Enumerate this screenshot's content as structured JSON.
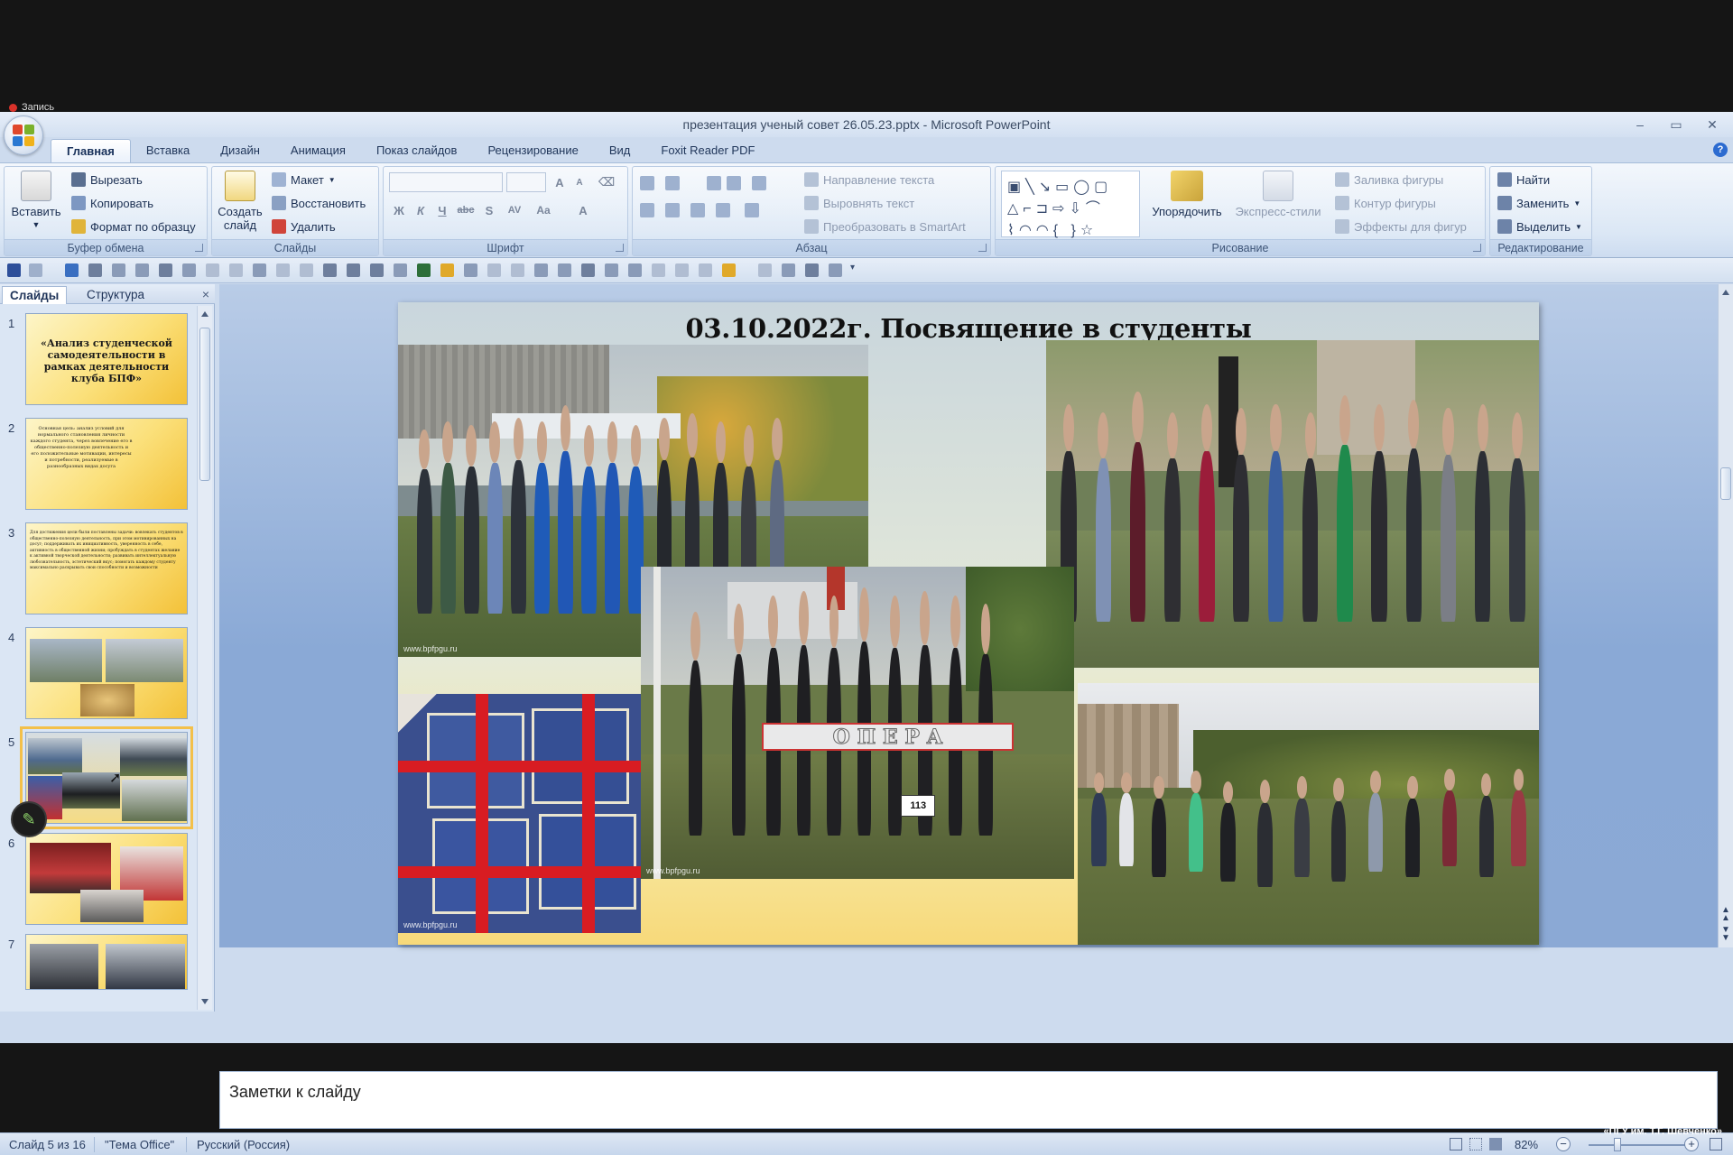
{
  "recording": {
    "label": "Запись"
  },
  "window": {
    "title": "презентация ученый совет 26.05.23.pptx - Microsoft PowerPoint",
    "controls": {
      "minimize": "–",
      "restore": "▭",
      "close": "✕"
    }
  },
  "tabs": [
    "Главная",
    "Вставка",
    "Дизайн",
    "Анимация",
    "Показ слайдов",
    "Рецензирование",
    "Вид",
    "Foxit Reader PDF"
  ],
  "active_tab": "Главная",
  "ribbon": {
    "clipboard": {
      "label": "Буфер обмена",
      "paste": "Вставить",
      "cut": "Вырезать",
      "copy": "Копировать",
      "format_painter": "Формат по образцу"
    },
    "slides": {
      "label": "Слайды",
      "new_slide": "Создать слайд",
      "layout": "Макет",
      "reset": "Восстановить",
      "delete": "Удалить"
    },
    "font": {
      "label": "Шрифт",
      "bold": "Ж",
      "italic": "К",
      "underline": "Ч",
      "strike": "abc",
      "shadow": "S",
      "spacing": "AV",
      "case": "Aa",
      "color": "A",
      "grow": "A",
      "shrink": "A"
    },
    "paragraph": {
      "label": "Абзац",
      "text_direction": "Направление текста",
      "align_text": "Выровнять текст",
      "smartart": "Преобразовать в SmartArt"
    },
    "drawing": {
      "label": "Рисование",
      "arrange": "Упорядочить",
      "quick_styles": "Экспресс-стили",
      "shape_fill": "Заливка фигуры",
      "shape_outline": "Контур фигуры",
      "shape_effects": "Эффекты для фигур"
    },
    "editing": {
      "label": "Редактирование",
      "find": "Найти",
      "replace": "Заменить",
      "select": "Выделить"
    }
  },
  "left_panel": {
    "tabs": [
      "Слайды",
      "Структура"
    ],
    "close": "×",
    "thumbnails": [
      {
        "num": "1",
        "text": "«Анализ студенческой самодеятельности в рамках деятельности клуба БПФ»"
      },
      {
        "num": "2",
        "text": "Основная цель: анализ условий для нормального становления личности каждого студента, через вовлечение его в общественно-полезную деятельность и его положительные мотивации, интересы и потребности, реализуемые в разнообразных видах досуга"
      },
      {
        "num": "3",
        "text": "Для достижения цели были поставлены задачи: вовлекать студентов в общественно-полезную деятельность, при этом мотивированных на досуг; поддерживать их инициативность, уверенность в себе, активность в общественной жизни; пробуждать в студентах желание к активной творческой деятельности; развивать интеллектуальную любознательность, эстетический вкус; помогать каждому студенту максимально раскрывать свои способности и возможности"
      },
      {
        "num": "4",
        "text": ""
      },
      {
        "num": "5",
        "text": ""
      },
      {
        "num": "6",
        "text": ""
      },
      {
        "num": "7",
        "text": ""
      }
    ]
  },
  "slide": {
    "title": "03.10.2022г. Посвящение в студенты",
    "watermark": "www.bpfpgu.ru",
    "sign_text": "О П Е Р А",
    "number_sign": "113"
  },
  "notes": {
    "placeholder": "Заметки к слайду"
  },
  "status": {
    "slide_pos": "Слайд 5 из 16",
    "theme": "\"Тема Office\"",
    "language": "Русский (Россия)",
    "zoom": "82%",
    "zoom_minus": "−",
    "zoom_plus": "+"
  },
  "brand": {
    "line1": "БПФ ГОУ",
    "line2": "«ПГУ им. Т.Г. Шевченко»"
  },
  "colors": {
    "ribbon": "#dbe7f5",
    "accent_yellow": "#f3c04a",
    "canvas_blue": "#8aa9d6"
  }
}
